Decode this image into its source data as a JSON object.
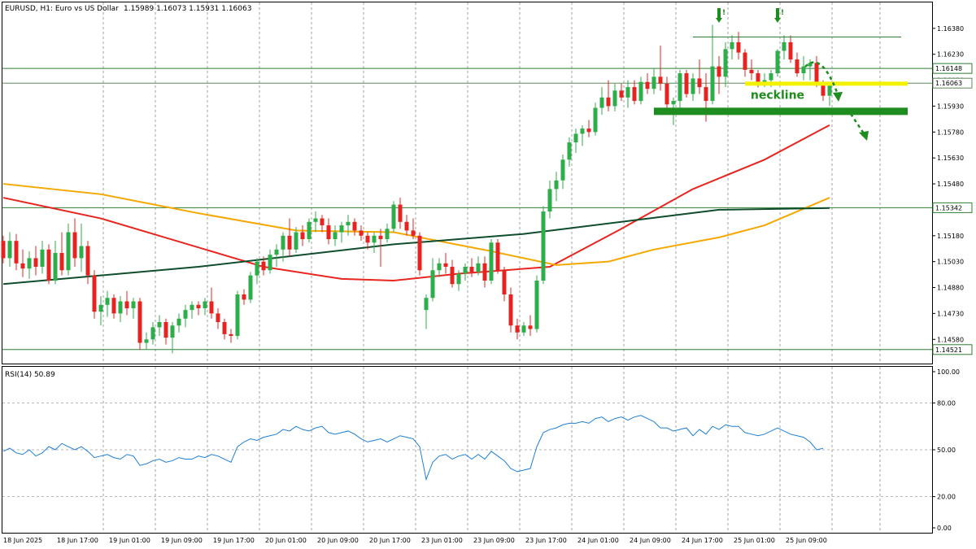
{
  "header": {
    "symbol": "EURUSD, H1:  Euro vs US Dollar",
    "ohlc": "1.15989 1.16073 1.15931 1.16063"
  },
  "chart_data": [
    {
      "type": "candlestick",
      "name": "EURUSD H1 price",
      "ylim": [
        1.1444,
        1.1653
      ],
      "y_ticks": [
        "1.16380",
        "1.16230",
        "1.16080",
        "1.15930",
        "1.15780",
        "1.15630",
        "1.15480",
        "1.15330",
        "1.15180",
        "1.15030",
        "1.14880",
        "1.14730",
        "1.14580"
      ],
      "y_tick_values": [
        1.1638,
        1.1623,
        1.1608,
        1.1593,
        1.1578,
        1.1563,
        1.1548,
        1.1533,
        1.1518,
        1.1503,
        1.1488,
        1.1473,
        1.1458
      ],
      "x_ticks": [
        "18 Jun 2025",
        "18 Jun 17:00",
        "19 Jun 01:00",
        "19 Jun 09:00",
        "19 Jun 17:00",
        "20 Jun 01:00",
        "20 Jun 09:00",
        "20 Jun 17:00",
        "23 Jun 01:00",
        "23 Jun 09:00",
        "23 Jun 17:00",
        "24 Jun 01:00",
        "24 Jun 09:00",
        "24 Jun 17:00",
        "25 Jun 01:00",
        "25 Jun 09:00"
      ],
      "candles_start_bar": 0,
      "candles": [
        [
          1.1515,
          1.1518,
          1.1502,
          1.1505
        ],
        [
          1.1505,
          1.152,
          1.15,
          1.1515
        ],
        [
          1.1515,
          1.1519,
          1.1498,
          1.1502
        ],
        [
          1.1502,
          1.151,
          1.1494,
          1.1499
        ],
        [
          1.1499,
          1.1509,
          1.1493,
          1.1505
        ],
        [
          1.1505,
          1.1512,
          1.1495,
          1.15
        ],
        [
          1.15,
          1.1515,
          1.1496,
          1.151
        ],
        [
          1.151,
          1.1513,
          1.149,
          1.1492
        ],
        [
          1.1492,
          1.1515,
          1.149,
          1.1508
        ],
        [
          1.1508,
          1.152,
          1.1495,
          1.1498
        ],
        [
          1.1498,
          1.1525,
          1.1495,
          1.152
        ],
        [
          1.152,
          1.1528,
          1.15,
          1.1505
        ],
        [
          1.1505,
          1.1525,
          1.1497,
          1.1512
        ],
        [
          1.1512,
          1.1515,
          1.149,
          1.1495
        ],
        [
          1.1495,
          1.1498,
          1.147,
          1.1474
        ],
        [
          1.1474,
          1.1483,
          1.1466,
          1.1478
        ],
        [
          1.1478,
          1.1486,
          1.1471,
          1.1482
        ],
        [
          1.1482,
          1.1484,
          1.147,
          1.1473
        ],
        [
          1.1473,
          1.1483,
          1.1468,
          1.148
        ],
        [
          1.148,
          1.1486,
          1.1472,
          1.1476
        ],
        [
          1.1476,
          1.1482,
          1.147,
          1.148
        ],
        [
          1.148,
          1.1482,
          1.1452,
          1.1456
        ],
        [
          1.1456,
          1.1462,
          1.1452,
          1.1458
        ],
        [
          1.1458,
          1.1468,
          1.1455,
          1.1465
        ],
        [
          1.1465,
          1.1472,
          1.146,
          1.1468
        ],
        [
          1.1468,
          1.147,
          1.1455,
          1.1459
        ],
        [
          1.1459,
          1.1468,
          1.145,
          1.1466
        ],
        [
          1.1466,
          1.1473,
          1.1462,
          1.147
        ],
        [
          1.147,
          1.1478,
          1.1465,
          1.1475
        ],
        [
          1.1475,
          1.148,
          1.147,
          1.1478
        ],
        [
          1.1478,
          1.148,
          1.1472,
          1.1476
        ],
        [
          1.1476,
          1.1482,
          1.1472,
          1.148
        ],
        [
          1.148,
          1.1488,
          1.147,
          1.1473
        ],
        [
          1.1473,
          1.1476,
          1.1464,
          1.1468
        ],
        [
          1.1468,
          1.147,
          1.1458,
          1.1461
        ],
        [
          1.1461,
          1.1464,
          1.1456,
          1.146
        ],
        [
          1.146,
          1.1486,
          1.1458,
          1.1484
        ],
        [
          1.1484,
          1.1487,
          1.1478,
          1.1481
        ],
        [
          1.1481,
          1.1497,
          1.1479,
          1.1495
        ],
        [
          1.1495,
          1.1505,
          1.149,
          1.1503
        ],
        [
          1.1503,
          1.1506,
          1.1495,
          1.1498
        ],
        [
          1.1498,
          1.151,
          1.1496,
          1.1507
        ],
        [
          1.1507,
          1.1513,
          1.15,
          1.151
        ],
        [
          1.151,
          1.152,
          1.1503,
          1.1518
        ],
        [
          1.1518,
          1.1528,
          1.1506,
          1.151
        ],
        [
          1.151,
          1.1523,
          1.1508,
          1.152
        ],
        [
          1.152,
          1.1524,
          1.1512,
          1.1516
        ],
        [
          1.1516,
          1.1528,
          1.1514,
          1.1526
        ],
        [
          1.1526,
          1.1532,
          1.152,
          1.1528
        ],
        [
          1.1528,
          1.153,
          1.152,
          1.1524
        ],
        [
          1.1524,
          1.1528,
          1.1513,
          1.1516
        ],
        [
          1.1516,
          1.1524,
          1.1512,
          1.152
        ],
        [
          1.152,
          1.1526,
          1.1514,
          1.1524
        ],
        [
          1.1524,
          1.153,
          1.1518,
          1.1526
        ],
        [
          1.1526,
          1.1528,
          1.1518,
          1.1521
        ],
        [
          1.1521,
          1.1524,
          1.1515,
          1.1518
        ],
        [
          1.1518,
          1.152,
          1.151,
          1.1514
        ],
        [
          1.1514,
          1.152,
          1.1508,
          1.1518
        ],
        [
          1.1518,
          1.1522,
          1.15,
          1.1516
        ],
        [
          1.1516,
          1.1525,
          1.1514,
          1.1522
        ],
        [
          1.1522,
          1.1538,
          1.152,
          1.1536
        ],
        [
          1.1536,
          1.154,
          1.1522,
          1.1526
        ],
        [
          1.1526,
          1.153,
          1.1518,
          1.1521
        ],
        [
          1.1521,
          1.1528,
          1.1516,
          1.1518
        ],
        [
          1.1518,
          1.152,
          1.1495,
          1.1498
        ],
        [
          1.1475,
          1.1484,
          1.1464,
          1.1482
        ],
        [
          1.1482,
          1.1505,
          1.148,
          1.1498
        ],
        [
          1.1498,
          1.1505,
          1.1494,
          1.1502
        ],
        [
          1.1502,
          1.1508,
          1.1496,
          1.15
        ],
        [
          1.15,
          1.1504,
          1.1488,
          1.149
        ],
        [
          1.149,
          1.1498,
          1.1486,
          1.1496
        ],
        [
          1.1496,
          1.1502,
          1.1492,
          1.15
        ],
        [
          1.15,
          1.1505,
          1.1494,
          1.1497
        ],
        [
          1.1497,
          1.1506,
          1.1495,
          1.1502
        ],
        [
          1.1502,
          1.1506,
          1.1488,
          1.1492
        ],
        [
          1.1492,
          1.1516,
          1.149,
          1.1514
        ],
        [
          1.1514,
          1.1516,
          1.1496,
          1.1498
        ],
        [
          1.1498,
          1.15,
          1.148,
          1.1484
        ],
        [
          1.1484,
          1.1488,
          1.1462,
          1.1466
        ],
        [
          1.1466,
          1.147,
          1.1458,
          1.1462
        ],
        [
          1.1462,
          1.1468,
          1.146,
          1.1466
        ],
        [
          1.1466,
          1.1472,
          1.146,
          1.1464
        ],
        [
          1.1464,
          1.1495,
          1.1462,
          1.1492
        ],
        [
          1.1492,
          1.1535,
          1.149,
          1.1532
        ],
        [
          1.1532,
          1.155,
          1.1528,
          1.1545
        ],
        [
          1.1545,
          1.1555,
          1.1538,
          1.155
        ],
        [
          1.155,
          1.1565,
          1.1545,
          1.1562
        ],
        [
          1.1562,
          1.1575,
          1.1558,
          1.1572
        ],
        [
          1.1572,
          1.158,
          1.1566,
          1.1577
        ],
        [
          1.1577,
          1.1582,
          1.157,
          1.158
        ],
        [
          1.158,
          1.1585,
          1.1575,
          1.1578
        ],
        [
          1.1578,
          1.1595,
          1.1576,
          1.1592
        ],
        [
          1.1592,
          1.1604,
          1.1588,
          1.1598
        ],
        [
          1.1598,
          1.1608,
          1.159,
          1.1593
        ],
        [
          1.1593,
          1.1606,
          1.159,
          1.1602
        ],
        [
          1.1602,
          1.1606,
          1.1596,
          1.1598
        ],
        [
          1.1598,
          1.1608,
          1.1592,
          1.1604
        ],
        [
          1.1604,
          1.1608,
          1.1594,
          1.1596
        ],
        [
          1.1596,
          1.161,
          1.1594,
          1.1607
        ],
        [
          1.1607,
          1.1612,
          1.16,
          1.1603
        ],
        [
          1.1603,
          1.1615,
          1.16,
          1.161
        ],
        [
          1.161,
          1.1628,
          1.1602,
          1.1606
        ],
        [
          1.1606,
          1.161,
          1.159,
          1.1594
        ],
        [
          1.1594,
          1.1598,
          1.1582,
          1.1596
        ],
        [
          1.1596,
          1.1614,
          1.1592,
          1.1612
        ],
        [
          1.1612,
          1.1614,
          1.1598,
          1.16
        ],
        [
          1.16,
          1.1612,
          1.1596,
          1.1609
        ],
        [
          1.1609,
          1.162,
          1.16,
          1.1604
        ],
        [
          1.1604,
          1.1612,
          1.1584,
          1.1596
        ],
        [
          1.1596,
          1.164,
          1.1594,
          1.1616
        ],
        [
          1.1616,
          1.1622,
          1.16,
          1.161
        ],
        [
          1.161,
          1.163,
          1.1604,
          1.1626
        ],
        [
          1.1626,
          1.1634,
          1.162,
          1.163
        ],
        [
          1.163,
          1.1636,
          1.162,
          1.1624
        ],
        [
          1.1624,
          1.1626,
          1.161,
          1.1614
        ],
        [
          1.1614,
          1.162,
          1.1608,
          1.1612
        ],
        [
          1.1612,
          1.1614,
          1.1603,
          1.1607
        ],
        [
          1.1607,
          1.1612,
          1.1604,
          1.1608
        ],
        [
          1.1608,
          1.1614,
          1.1604,
          1.1612
        ],
        [
          1.1612,
          1.1626,
          1.161,
          1.1625
        ],
        [
          1.1625,
          1.1634,
          1.162,
          1.163
        ],
        [
          1.163,
          1.1634,
          1.1618,
          1.162
        ],
        [
          1.162,
          1.1624,
          1.161,
          1.1612
        ],
        [
          1.1612,
          1.1622,
          1.1608,
          1.1616
        ],
        [
          1.1616,
          1.162,
          1.1608,
          1.1618
        ],
        [
          1.1618,
          1.1622,
          1.1604,
          1.1606
        ],
        [
          1.1606,
          1.1608,
          1.1596,
          1.1599
        ],
        [
          1.1599,
          1.1607,
          1.1593,
          1.1606
        ]
      ],
      "moving_averages": [
        {
          "color": "#e8251f",
          "points": [
            [
              0,
              1.154
            ],
            [
              15,
              1.1528
            ],
            [
              40,
              1.15
            ],
            [
              52,
              1.1493
            ],
            [
              60,
              1.1492
            ],
            [
              70,
              1.1496
            ],
            [
              84,
              1.15
            ],
            [
              95,
              1.1522
            ],
            [
              106,
              1.1545
            ],
            [
              117,
              1.1562
            ],
            [
              127,
              1.1582
            ]
          ]
        },
        {
          "color": "#f5a800",
          "points": [
            [
              0,
              1.1548
            ],
            [
              15,
              1.1542
            ],
            [
              30,
              1.1531
            ],
            [
              45,
              1.1521
            ],
            [
              60,
              1.152
            ],
            [
              75,
              1.1509
            ],
            [
              85,
              1.1501
            ],
            [
              93,
              1.1503
            ],
            [
              100,
              1.151
            ],
            [
              110,
              1.1517
            ],
            [
              117,
              1.1524
            ],
            [
              127,
              1.154
            ]
          ]
        },
        {
          "color": "#0f4d2c",
          "points": [
            [
              0,
              1.149
            ],
            [
              30,
              1.15
            ],
            [
              60,
              1.1513
            ],
            [
              80,
              1.1519
            ],
            [
              95,
              1.1526
            ],
            [
              110,
              1.1533
            ],
            [
              127,
              1.1534
            ]
          ]
        }
      ],
      "horizontal_levels": [
        {
          "value": 1.16148,
          "label": "1.16148",
          "color": "#2e7d32",
          "width": 1
        },
        {
          "value": 1.16063,
          "label": "1.16063",
          "color": "#5c8a5c",
          "width": 1
        },
        {
          "value": 1.15342,
          "label": "1.15342",
          "color": "#2e7d32",
          "width": 1
        },
        {
          "value": 1.14521,
          "label": "1.14521",
          "color": "#2e7d32",
          "width": 1
        }
      ],
      "drawn_lines": [
        {
          "value": 1.1633,
          "from_bar": 106,
          "to_bar": 138,
          "color": "#2e7d32",
          "width": 1
        },
        {
          "value": 1.1606,
          "from_bar": 114,
          "to_bar": 139,
          "color": "#f2f200",
          "width": 5
        },
        {
          "value": 1.159,
          "from_bar": 100,
          "to_bar": 139,
          "color": "#1e8c1e",
          "width": 9
        }
      ],
      "annotations": [
        {
          "text": "neckline",
          "bar": 119,
          "value": 1.1602
        }
      ],
      "markers": [
        {
          "symbol": "!",
          "bar": 110,
          "value": 1.1645
        },
        {
          "symbol": "!",
          "bar": 119,
          "value": 1.1645
        }
      ],
      "colors": {
        "bull": "#2eae4a",
        "bear": "#e52421",
        "grid": "#8c8c8c"
      }
    },
    {
      "type": "line",
      "name": "RSI",
      "label": "RSI(14) 50.89",
      "ylim": [
        0,
        100
      ],
      "y_ticks": [
        "100.00",
        "80.00",
        "50.00",
        "20.00",
        "0.00"
      ],
      "y_tick_values": [
        100,
        80,
        50,
        20,
        0
      ],
      "levels": [
        80,
        50,
        20
      ],
      "color": "#1e7fd6",
      "start_bar": 0,
      "values": [
        49,
        51,
        48,
        47,
        50,
        46,
        48,
        52,
        50,
        54,
        52,
        50,
        52,
        49,
        45,
        46,
        47,
        45,
        44,
        47,
        46,
        40,
        41,
        43,
        44,
        42,
        43,
        45,
        44,
        44,
        46,
        45,
        47,
        46,
        44,
        42,
        52,
        55,
        57,
        56,
        58,
        59,
        60,
        63,
        62,
        65,
        63,
        62,
        64,
        65,
        61,
        60,
        61,
        62,
        60,
        57,
        55,
        56,
        57,
        55,
        57,
        59,
        58,
        57,
        52,
        31,
        42,
        46,
        47,
        44,
        46,
        47,
        44,
        47,
        44,
        49,
        46,
        43,
        38,
        36,
        37,
        38,
        52,
        61,
        63,
        64,
        66,
        67,
        67,
        68,
        67,
        70,
        71,
        68,
        70,
        71,
        69,
        71,
        72,
        70,
        68,
        64,
        64,
        62,
        63,
        64,
        59,
        63,
        60,
        65,
        63,
        66,
        65,
        65,
        61,
        60,
        59,
        60,
        62,
        64,
        62,
        60,
        59,
        58,
        55,
        50,
        50.89
      ],
      "colors": {
        "level": "#a0a0a0"
      }
    }
  ]
}
